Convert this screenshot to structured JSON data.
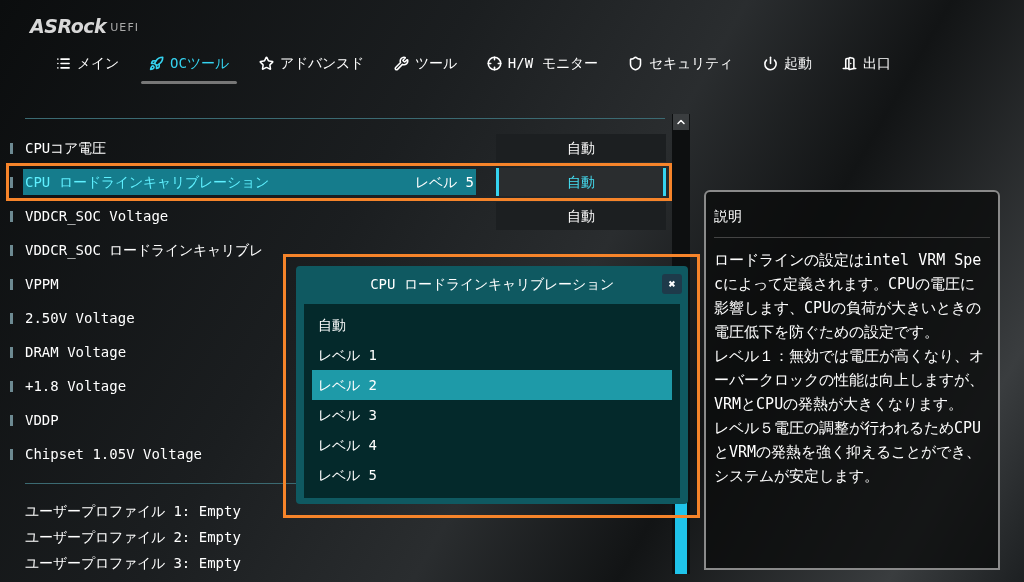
{
  "header": {
    "logo": "ASRock",
    "logo_suffix": "UEFI"
  },
  "tabs": [
    {
      "label": "メイン",
      "selected": false
    },
    {
      "label": "OCツール",
      "selected": true
    },
    {
      "label": "アドバンスド",
      "selected": false
    },
    {
      "label": "ツール",
      "selected": false
    },
    {
      "label": "H/W モニター",
      "selected": false
    },
    {
      "label": "セキュリティ",
      "selected": false
    },
    {
      "label": "起動",
      "selected": false
    },
    {
      "label": "出口",
      "selected": false
    }
  ],
  "settings": [
    {
      "label": "CPUコア電圧",
      "value": "自動",
      "selected": false,
      "highlighted": false
    },
    {
      "label": "CPU ロードラインキャリブレーション",
      "current": "レベル 5",
      "value": "自動",
      "selected": true,
      "highlighted": true
    },
    {
      "label": "VDDCR_SOC Voltage",
      "value": "自動",
      "selected": false,
      "highlighted": false
    },
    {
      "label": "VDDCR_SOC ロードラインキャリブレ",
      "selected": false,
      "highlighted": false
    },
    {
      "label": "VPPM",
      "selected": false,
      "highlighted": false
    },
    {
      "label": "2.50V Voltage",
      "selected": false,
      "highlighted": false
    },
    {
      "label": "DRAM Voltage",
      "selected": false,
      "highlighted": false
    },
    {
      "label": "+1.8 Voltage",
      "selected": false,
      "highlighted": false
    },
    {
      "label": "VDDP",
      "selected": false,
      "highlighted": false
    },
    {
      "label": "Chipset 1.05V Voltage",
      "selected": false,
      "highlighted": false
    }
  ],
  "profiles": [
    "ユーザープロファイル 1: Empty",
    "ユーザープロファイル 2: Empty",
    "ユーザープロファイル 3: Empty"
  ],
  "description": {
    "title": "説明",
    "paragraphs": [
      "ロードラインの設定はintel VRM Specによって定義されます。CPUの電圧に影響します、CPUの負荷が大きいときの電圧低下を防ぐための設定です。",
      "レベル１：無効では電圧が高くなり、オーバークロックの性能は向上しますが、VRMとCPUの発熱が大きくなります。",
      "レベル５電圧の調整が行われるためCPUとVRMの発熱を強く抑えることができ、システムが安定します。"
    ]
  },
  "popup": {
    "title": "CPU ロードラインキャリブレーション",
    "close": "✖",
    "highlighted": true,
    "options": [
      {
        "label": "自動",
        "selected": false
      },
      {
        "label": "レベル 1",
        "selected": false
      },
      {
        "label": "レベル 2",
        "selected": true
      },
      {
        "label": "レベル 3",
        "selected": false
      },
      {
        "label": "レベル 4",
        "selected": false
      },
      {
        "label": "レベル 5",
        "selected": false
      }
    ]
  }
}
